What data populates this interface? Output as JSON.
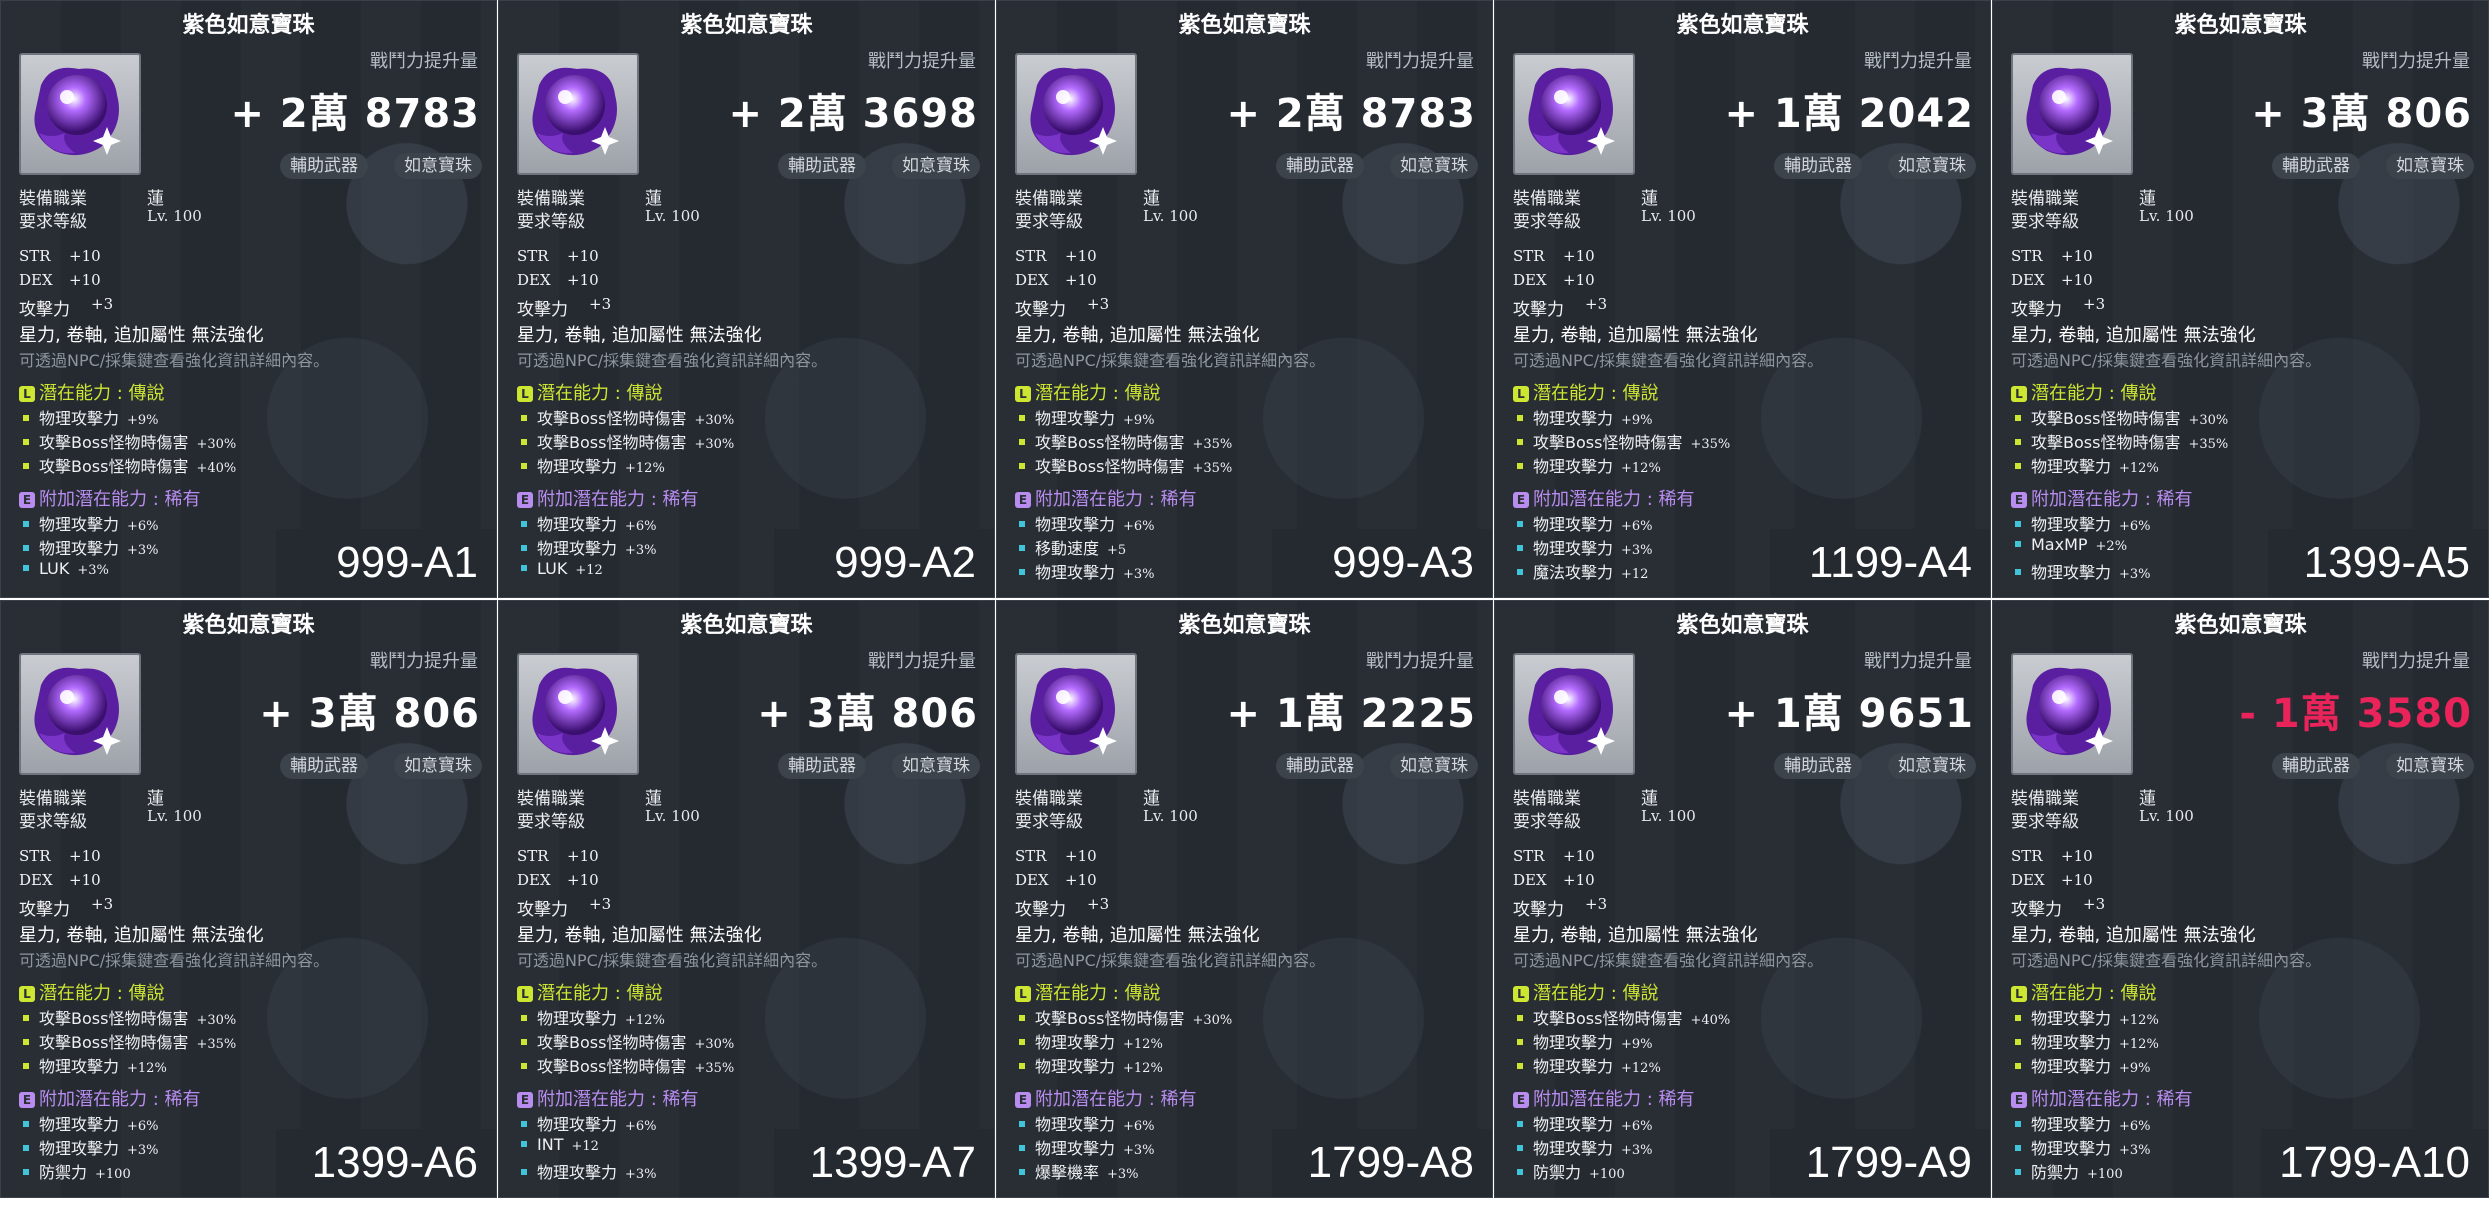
{
  "common": {
    "title": "紫色如意寶珠",
    "cp_label": "戰鬥力提升量",
    "tags": [
      "輔助武器",
      "如意寶珠"
    ],
    "job_label": "裝備職業",
    "job_value": "蓮",
    "level_label": "要求等級",
    "level_value": "Lv. 100",
    "base_stats": [
      {
        "name": "STR",
        "value": "+10"
      },
      {
        "name": "DEX",
        "value": "+10"
      },
      {
        "name": "攻擊力",
        "value": "+3"
      }
    ],
    "notice": "星力, 卷軸, 追加屬性 無法強化",
    "subnote": "可透過NPC/採集鍵查看強化資訊詳細內容。",
    "potential_head": "潛在能力 : 傳說",
    "bonus_head": "附加潛在能力 : 稀有",
    "potential_icon": "L",
    "bonus_icon": "E"
  },
  "colors": {
    "card_bg": "#252a31",
    "legendary": "#cde632",
    "rare": "#b98cf0",
    "negative": "#e8245a",
    "bullet_bonus": "#42c4d8"
  },
  "cards": [
    {
      "cp": "+ 2萬 8783",
      "negative": false,
      "label": "999-A1",
      "potential": [
        [
          "物理攻擊力",
          "+9%"
        ],
        [
          "攻擊Boss怪物時傷害",
          "+30%"
        ],
        [
          "攻擊Boss怪物時傷害",
          "+40%"
        ]
      ],
      "bonus": [
        [
          "物理攻擊力",
          "+6%"
        ],
        [
          "物理攻擊力",
          "+3%"
        ],
        [
          "LUK",
          "+3%"
        ]
      ]
    },
    {
      "cp": "+ 2萬 3698",
      "negative": false,
      "label": "999-A2",
      "potential": [
        [
          "攻擊Boss怪物時傷害",
          "+30%"
        ],
        [
          "攻擊Boss怪物時傷害",
          "+30%"
        ],
        [
          "物理攻擊力",
          "+12%"
        ]
      ],
      "bonus": [
        [
          "物理攻擊力",
          "+6%"
        ],
        [
          "物理攻擊力",
          "+3%"
        ],
        [
          "LUK",
          "+12"
        ]
      ]
    },
    {
      "cp": "+ 2萬 8783",
      "negative": false,
      "label": "999-A3",
      "potential": [
        [
          "物理攻擊力",
          "+9%"
        ],
        [
          "攻擊Boss怪物時傷害",
          "+35%"
        ],
        [
          "攻擊Boss怪物時傷害",
          "+35%"
        ]
      ],
      "bonus": [
        [
          "物理攻擊力",
          "+6%"
        ],
        [
          "移動速度",
          "+5"
        ],
        [
          "物理攻擊力",
          "+3%"
        ]
      ]
    },
    {
      "cp": "+ 1萬 2042",
      "negative": false,
      "label": "1199-A4",
      "potential": [
        [
          "物理攻擊力",
          "+9%"
        ],
        [
          "攻擊Boss怪物時傷害",
          "+35%"
        ],
        [
          "物理攻擊力",
          "+12%"
        ]
      ],
      "bonus": [
        [
          "物理攻擊力",
          "+6%"
        ],
        [
          "物理攻擊力",
          "+3%"
        ],
        [
          "魔法攻擊力",
          "+12"
        ]
      ]
    },
    {
      "cp": "+ 3萬 806",
      "negative": false,
      "label": "1399-A5",
      "potential": [
        [
          "攻擊Boss怪物時傷害",
          "+30%"
        ],
        [
          "攻擊Boss怪物時傷害",
          "+35%"
        ],
        [
          "物理攻擊力",
          "+12%"
        ]
      ],
      "bonus": [
        [
          "物理攻擊力",
          "+6%"
        ],
        [
          "MaxMP",
          "+2%"
        ],
        [
          "物理攻擊力",
          "+3%"
        ]
      ]
    },
    {
      "cp": "+ 3萬 806",
      "negative": false,
      "label": "1399-A6",
      "potential": [
        [
          "攻擊Boss怪物時傷害",
          "+30%"
        ],
        [
          "攻擊Boss怪物時傷害",
          "+35%"
        ],
        [
          "物理攻擊力",
          "+12%"
        ]
      ],
      "bonus": [
        [
          "物理攻擊力",
          "+6%"
        ],
        [
          "物理攻擊力",
          "+3%"
        ],
        [
          "防禦力",
          "+100"
        ]
      ]
    },
    {
      "cp": "+ 3萬 806",
      "negative": false,
      "label": "1399-A7",
      "potential": [
        [
          "物理攻擊力",
          "+12%"
        ],
        [
          "攻擊Boss怪物時傷害",
          "+30%"
        ],
        [
          "攻擊Boss怪物時傷害",
          "+35%"
        ]
      ],
      "bonus": [
        [
          "物理攻擊力",
          "+6%"
        ],
        [
          "INT",
          "+12"
        ],
        [
          "物理攻擊力",
          "+3%"
        ]
      ]
    },
    {
      "cp": "+ 1萬 2225",
      "negative": false,
      "label": "1799-A8",
      "potential": [
        [
          "攻擊Boss怪物時傷害",
          "+30%"
        ],
        [
          "物理攻擊力",
          "+12%"
        ],
        [
          "物理攻擊力",
          "+12%"
        ]
      ],
      "bonus": [
        [
          "物理攻擊力",
          "+6%"
        ],
        [
          "物理攻擊力",
          "+3%"
        ],
        [
          "爆擊機率",
          "+3%"
        ]
      ]
    },
    {
      "cp": "+ 1萬 9651",
      "negative": false,
      "label": "1799-A9",
      "potential": [
        [
          "攻擊Boss怪物時傷害",
          "+40%"
        ],
        [
          "物理攻擊力",
          "+9%"
        ],
        [
          "物理攻擊力",
          "+12%"
        ]
      ],
      "bonus": [
        [
          "物理攻擊力",
          "+6%"
        ],
        [
          "物理攻擊力",
          "+3%"
        ],
        [
          "防禦力",
          "+100"
        ]
      ]
    },
    {
      "cp": "- 1萬 3580",
      "negative": true,
      "label": "1799-A10",
      "potential": [
        [
          "物理攻擊力",
          "+12%"
        ],
        [
          "物理攻擊力",
          "+12%"
        ],
        [
          "物理攻擊力",
          "+9%"
        ]
      ],
      "bonus": [
        [
          "物理攻擊力",
          "+6%"
        ],
        [
          "物理攻擊力",
          "+3%"
        ],
        [
          "防禦力",
          "+100"
        ]
      ]
    }
  ]
}
